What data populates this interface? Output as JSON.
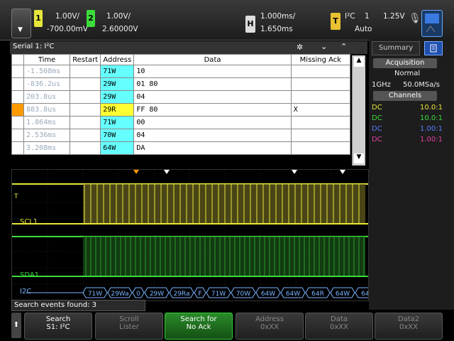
{
  "topbar": {
    "ch1": {
      "num": "1",
      "scale": "1.00V/",
      "offset": "-700.00mV",
      "color": "#e6e63c"
    },
    "ch2": {
      "num": "2",
      "scale": "1.00V/",
      "offset": "2.60000V",
      "color": "#3cdc3c"
    },
    "horiz": {
      "label": "H",
      "timebase": "1.000ms/",
      "delay": "1.650ms"
    },
    "trigger": {
      "label": "T",
      "type": "I²C",
      "channel": "1",
      "level": "1.25V",
      "mode": "Auto"
    }
  },
  "lister": {
    "title": "Serial 1: I²C",
    "columns": [
      "Time",
      "Restart",
      "Address",
      "Data",
      "Missing Ack"
    ],
    "rows": [
      {
        "time": "-1.508ms",
        "restart": "",
        "address": "71W",
        "data": "10",
        "ack": "",
        "highlight": false
      },
      {
        "time": "-836.2us",
        "restart": "",
        "address": "29W",
        "data": "01 80",
        "ack": "",
        "highlight": false
      },
      {
        "time": "203.8us",
        "restart": "",
        "address": "29W",
        "data": "04",
        "ack": "",
        "highlight": false
      },
      {
        "time": "883.8us",
        "restart": "",
        "address": "29R",
        "data": "FF 80",
        "ack": "X",
        "highlight": true
      },
      {
        "time": "1.864ms",
        "restart": "",
        "address": "71W",
        "data": "00",
        "ack": "",
        "highlight": false
      },
      {
        "time": "2.536ms",
        "restart": "",
        "address": "70W",
        "data": "04",
        "ack": "",
        "highlight": false
      },
      {
        "time": "3.208ms",
        "restart": "",
        "address": "64W",
        "data": "DA",
        "ack": "",
        "highlight": false
      }
    ]
  },
  "waveform": {
    "scl_label": "SCL1",
    "sda_label": "SDA1",
    "bus_label": "I2C",
    "trig_marker": "T",
    "decode": [
      "71W",
      "29Wa",
      "0",
      "29W",
      "29Ra",
      "F",
      "71W",
      "70W",
      "64W",
      "64W",
      "64R",
      "64W",
      "64R"
    ]
  },
  "summary": {
    "tab": "Summary",
    "acquisition": "Acquisition",
    "mode": "Normal",
    "bandwidth": "1GHz",
    "rate": "50.0MSa/s",
    "channels": "Channels",
    "channel_rows": [
      {
        "name": "DC",
        "value": "10.0:1",
        "color": "#e6e63c"
      },
      {
        "name": "DC",
        "value": "10.0:1",
        "color": "#3cdc3c"
      },
      {
        "name": "DC",
        "value": "1.00:1",
        "color": "#5a7cff"
      },
      {
        "name": "DC",
        "value": "1.00:1",
        "color": "#e040a0"
      }
    ]
  },
  "status": {
    "text": "Search events found: 3"
  },
  "softkeys": [
    {
      "l1": "Search",
      "l2": "S1: I²C"
    },
    {
      "l1": "Scroll",
      "l2": "Lister"
    },
    {
      "l1": "Search for",
      "l2": "No Ack"
    },
    {
      "l1": "Address",
      "l2": "0xXX"
    },
    {
      "l1": "Data",
      "l2": "0xXX"
    },
    {
      "l1": "Data2",
      "l2": "0xXX"
    }
  ]
}
